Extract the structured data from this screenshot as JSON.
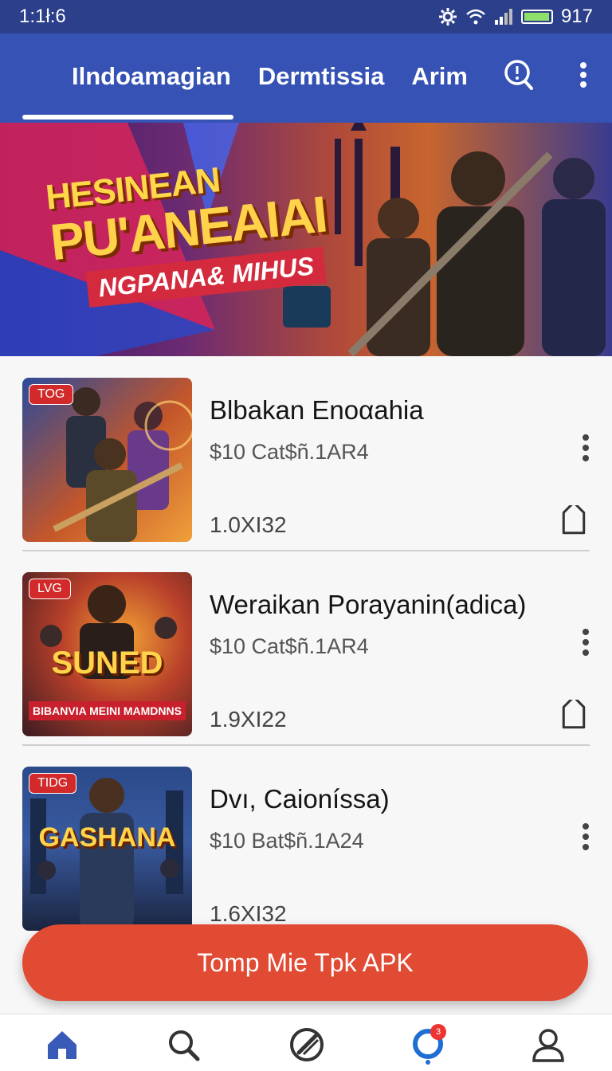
{
  "status_bar": {
    "time": "1:1ł:6",
    "battery_text": "917",
    "battery_level": 0.85
  },
  "tabs": [
    {
      "label": "Ilndoamagian"
    },
    {
      "label": "Dermtissia"
    },
    {
      "label": "Arim"
    }
  ],
  "active_tab": 0,
  "banner": {
    "title_line1": "HESINEAN",
    "title_line2": "PU'ANEAIAI",
    "title_line3": "NGPANA& MIHUS"
  },
  "items": [
    {
      "tag": "TOG",
      "title": "Blbakan Enoαahia",
      "subtitle": "$10 Cat$ñ.1AR4",
      "size": "1.0XI32",
      "thumb_logo": "",
      "thumb_strip": ""
    },
    {
      "tag": "LVG",
      "title": "Weraikan Porayanin(adica)",
      "subtitle": "$10 Cat$ñ.1AR4",
      "size": "1.9XI22",
      "thumb_logo": "SUNED",
      "thumb_strip": "BIBANVIA MEINI MAMDNNS"
    },
    {
      "tag": "TIDG",
      "title": "Dvı, Caioníssa)",
      "subtitle": "$10 Bat$ñ.1A24",
      "size": "1.6XI32",
      "thumb_logo": "GASHANA",
      "thumb_strip": ""
    }
  ],
  "cta": {
    "label": "Tomp Mie Tpk APK"
  },
  "bottom_nav": [
    {
      "icon": "home-icon"
    },
    {
      "icon": "search-icon"
    },
    {
      "icon": "edit-icon"
    },
    {
      "icon": "notification-icon",
      "badge": "3"
    },
    {
      "icon": "profile-icon"
    }
  ],
  "colors": {
    "status_bar": "#2b3f8a",
    "app_bar": "#3552b4",
    "cta": "#e14a33",
    "nav_active": "#1f6ed4"
  }
}
